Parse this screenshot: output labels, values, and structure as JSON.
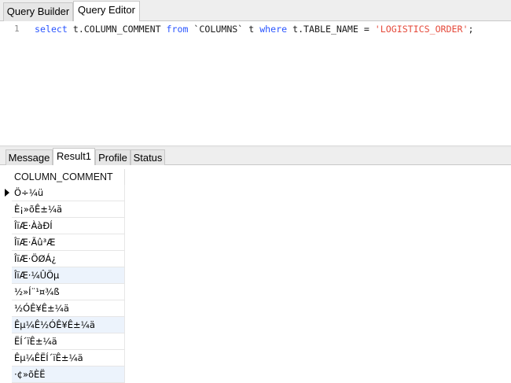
{
  "top_tabs": [
    {
      "label": "Query Builder",
      "active": false
    },
    {
      "label": "Query Editor",
      "active": true
    }
  ],
  "editor": {
    "line_number": "1",
    "sql": {
      "kw_select": "select",
      "expr": " t.COLUMN_COMMENT ",
      "kw_from": "from",
      "table": " `COLUMNS` t ",
      "kw_where": "where",
      "cond": " t.TABLE_NAME = ",
      "literal": "'LOGISTICS_ORDER'",
      "end": ";"
    }
  },
  "result_tabs": [
    {
      "label": "Message",
      "active": false
    },
    {
      "label": "Result1",
      "active": true
    },
    {
      "label": "Profile",
      "active": false
    },
    {
      "label": "Status",
      "active": false
    }
  ],
  "grid": {
    "column_header": "COLUMN_COMMENT",
    "rows": [
      "Ö÷¼ü",
      " È¡»õÊ±¼ä",
      "ÎïÆ·ÀàÐÍ",
      "ÎïÆ·Ãû³Æ",
      "ÎïÆ·ÖØÁ¿",
      "ÎïÆ·¼ÛÖµ",
      "½»Í¨¹¤¾ß",
      "½ÓÊ¥Ê±¼ä",
      "Êµ¼Ê½ÓÊ¥Ê±¼ä",
      "ËÍ´ïÊ±¼ä",
      "Êµ¼ÊËÍ´ïÊ±¼ä",
      "·¢»õÈË"
    ]
  },
  "colors": {
    "keyword": "#2a55ff",
    "string": "#e5493a",
    "alt_row": "#ecf3fc"
  }
}
